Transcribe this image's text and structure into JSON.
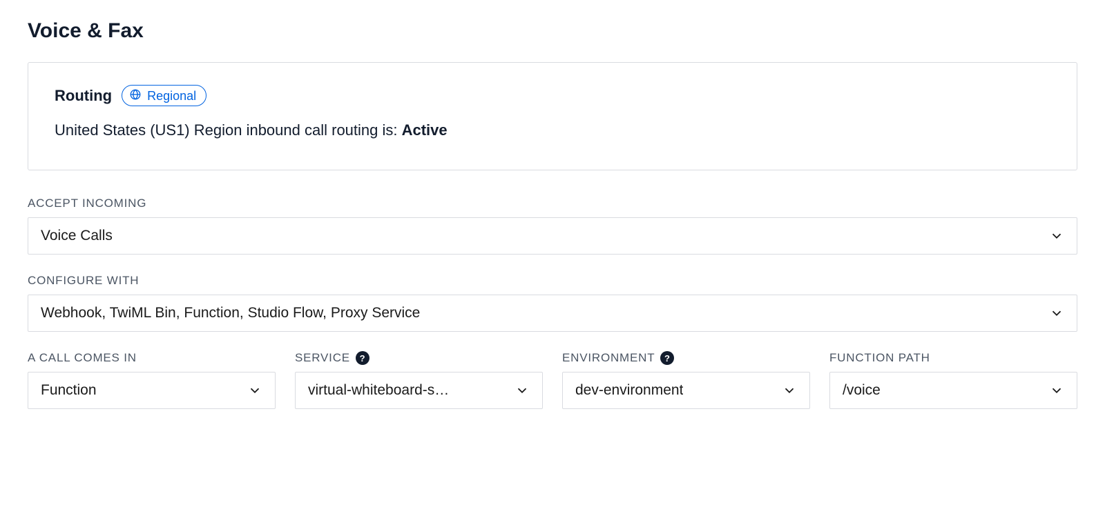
{
  "section_title": "Voice & Fax",
  "routing": {
    "title": "Routing",
    "chip_label": "Regional",
    "status_prefix": "United States (US1) Region inbound call routing is: ",
    "status_value": "Active"
  },
  "fields": {
    "accept_incoming": {
      "label": "ACCEPT INCOMING",
      "value": "Voice Calls"
    },
    "configure_with": {
      "label": "CONFIGURE WITH",
      "value": "Webhook, TwiML Bin, Function, Studio Flow, Proxy Service"
    },
    "call_comes_in": {
      "label": "A CALL COMES IN",
      "value": "Function"
    },
    "service": {
      "label": "SERVICE",
      "value": "virtual-whiteboard-s…"
    },
    "environment": {
      "label": "ENVIRONMENT",
      "value": "dev-environment"
    },
    "function_path": {
      "label": "FUNCTION PATH",
      "value": "/voice"
    }
  },
  "help_glyph": "?"
}
